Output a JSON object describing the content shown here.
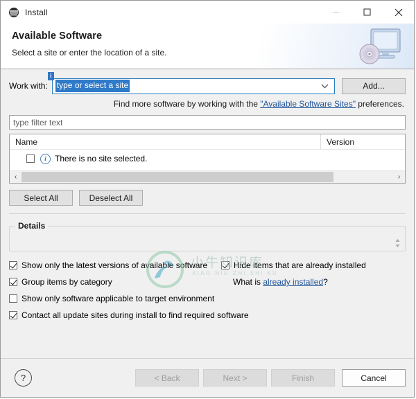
{
  "window": {
    "title": "Install",
    "app_icon": "eclipse-install-icon",
    "controls": {
      "minimize": "—",
      "maximize": "☐",
      "close": "✕"
    }
  },
  "banner": {
    "title": "Available Software",
    "subtitle": "Select a site or enter the location of a site.",
    "graphic": "monitor-cd-icon"
  },
  "work_with": {
    "label": "Work with:",
    "value": "type or select a site",
    "placeholder": "type or select a site",
    "info_badge": "i",
    "dropdown_icon": "chevron-down-icon",
    "add_button": "Add..."
  },
  "hint": {
    "prefix": "Find more software by working with the ",
    "link": "\"Available Software Sites\"",
    "suffix": " preferences."
  },
  "filter": {
    "placeholder": "type filter text",
    "value": ""
  },
  "table": {
    "columns": [
      "Name",
      "Version"
    ],
    "rows": [
      {
        "checked": false,
        "icon": "info-icon",
        "name": "There is no site selected.",
        "version": ""
      }
    ],
    "scrollbar": {
      "left_arrow": "‹",
      "right_arrow": "›"
    }
  },
  "selection_buttons": {
    "select_all": "Select All",
    "deselect_all": "Deselect All"
  },
  "details": {
    "legend": "Details",
    "content": ""
  },
  "options": [
    {
      "label": "Show only the latest versions of available software",
      "checked": true
    },
    {
      "label": "Hide items that are already installed",
      "checked": true
    },
    {
      "label": "Group items by category",
      "checked": true
    },
    {
      "label": "Show only software applicable to target environment",
      "checked": false
    },
    {
      "label": "Contact all update sites during install to find required software",
      "checked": true
    }
  ],
  "already_installed": {
    "prefix": "What is ",
    "link": "already installed",
    "suffix": "?"
  },
  "footer": {
    "help": "?",
    "back": "< Back",
    "next": "Next >",
    "finish": "Finish",
    "cancel": "Cancel",
    "back_enabled": false,
    "next_enabled": false,
    "finish_enabled": false,
    "cancel_enabled": true
  },
  "watermark": {
    "cn": "小牛知识库",
    "pinyin": "XIAO NIU ZHI SHI KU"
  },
  "colors": {
    "accent": "#2f7ac9",
    "link": "#22559c",
    "banner": "#dce8f7",
    "background": "#f0f0f0"
  }
}
